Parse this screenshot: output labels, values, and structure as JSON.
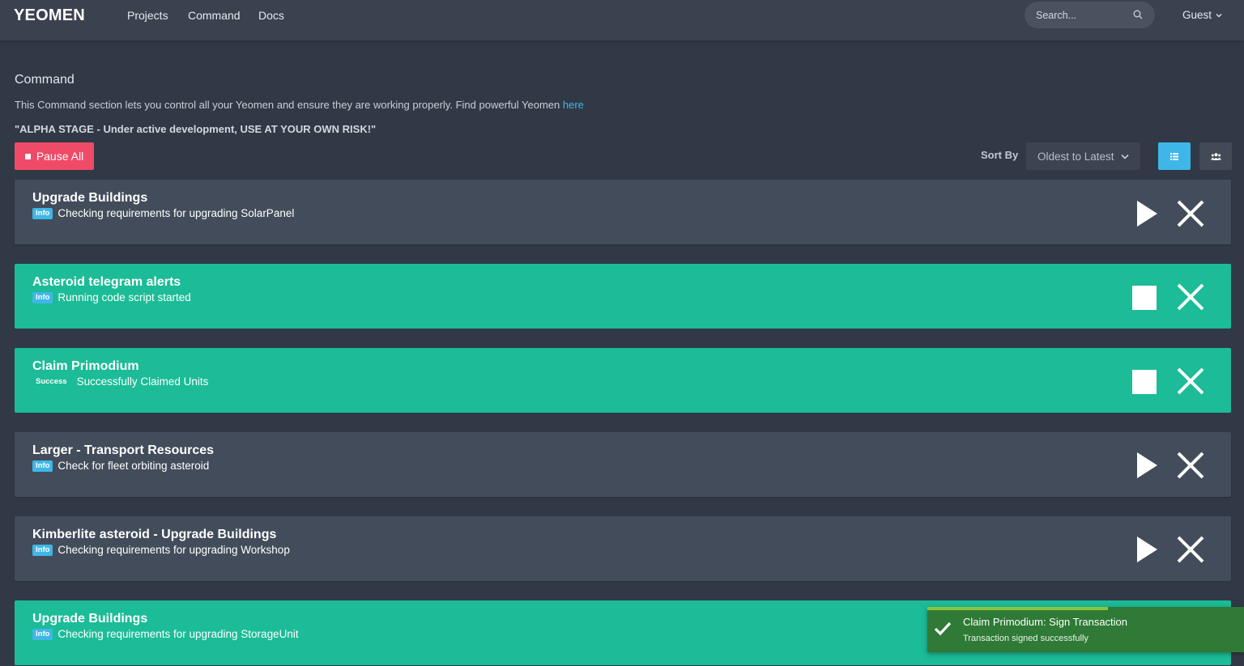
{
  "nav": {
    "brand": "YEOMEN",
    "links": [
      "Projects",
      "Command",
      "Docs"
    ],
    "search_placeholder": "Search...",
    "user": "Guest"
  },
  "page": {
    "title": "Command",
    "description": "This Command section lets you control all your Yeomen and ensure they are working properly. Find powerful Yeomen ",
    "description_link": "here",
    "warning": "\"ALPHA STAGE - Under active development, USE AT YOUR OWN RISK!\""
  },
  "toolbar": {
    "pause_all_label": "Pause All",
    "sort_label": "Sort By",
    "sort_value": "Oldest to Latest"
  },
  "tasks": [
    {
      "name": "Upgrade Buildings",
      "badge": "Info",
      "message": "Checking requirements for upgrading SolarPanel",
      "state": "idle"
    },
    {
      "name": "Asteroid telegram alerts",
      "badge": "Info",
      "message": "Running code script started",
      "state": "running"
    },
    {
      "name": "Claim Primodium",
      "badge": "Success",
      "message": "Successfully Claimed Units",
      "state": "running"
    },
    {
      "name": "Larger - Transport Resources",
      "badge": "Info",
      "message": "Check for fleet orbiting asteroid",
      "state": "idle"
    },
    {
      "name": "Kimberlite asteroid - Upgrade Buildings",
      "badge": "Info",
      "message": "Checking requirements for upgrading Workshop",
      "state": "idle"
    },
    {
      "name": "Upgrade Buildings",
      "badge": "Info",
      "message": "Checking requirements for upgrading StorageUnit",
      "state": "running"
    }
  ],
  "toast": {
    "title": "Claim Primodium: Sign Transaction",
    "message": "Transaction signed successfully",
    "progress": 0.57
  },
  "colors": {
    "background": "#313946",
    "accent_blue": "#3fb6e8",
    "running_green": "#1bbc97",
    "danger_red": "#ef4b67",
    "toast_green": "#2f7a36"
  },
  "icons": {
    "search": "search-icon",
    "chevron": "chevron-down-icon",
    "list_view": "list-view-icon",
    "group_view": "group-view-icon",
    "play": "play-icon",
    "stop": "stop-icon",
    "close": "close-icon",
    "check": "check-icon"
  }
}
